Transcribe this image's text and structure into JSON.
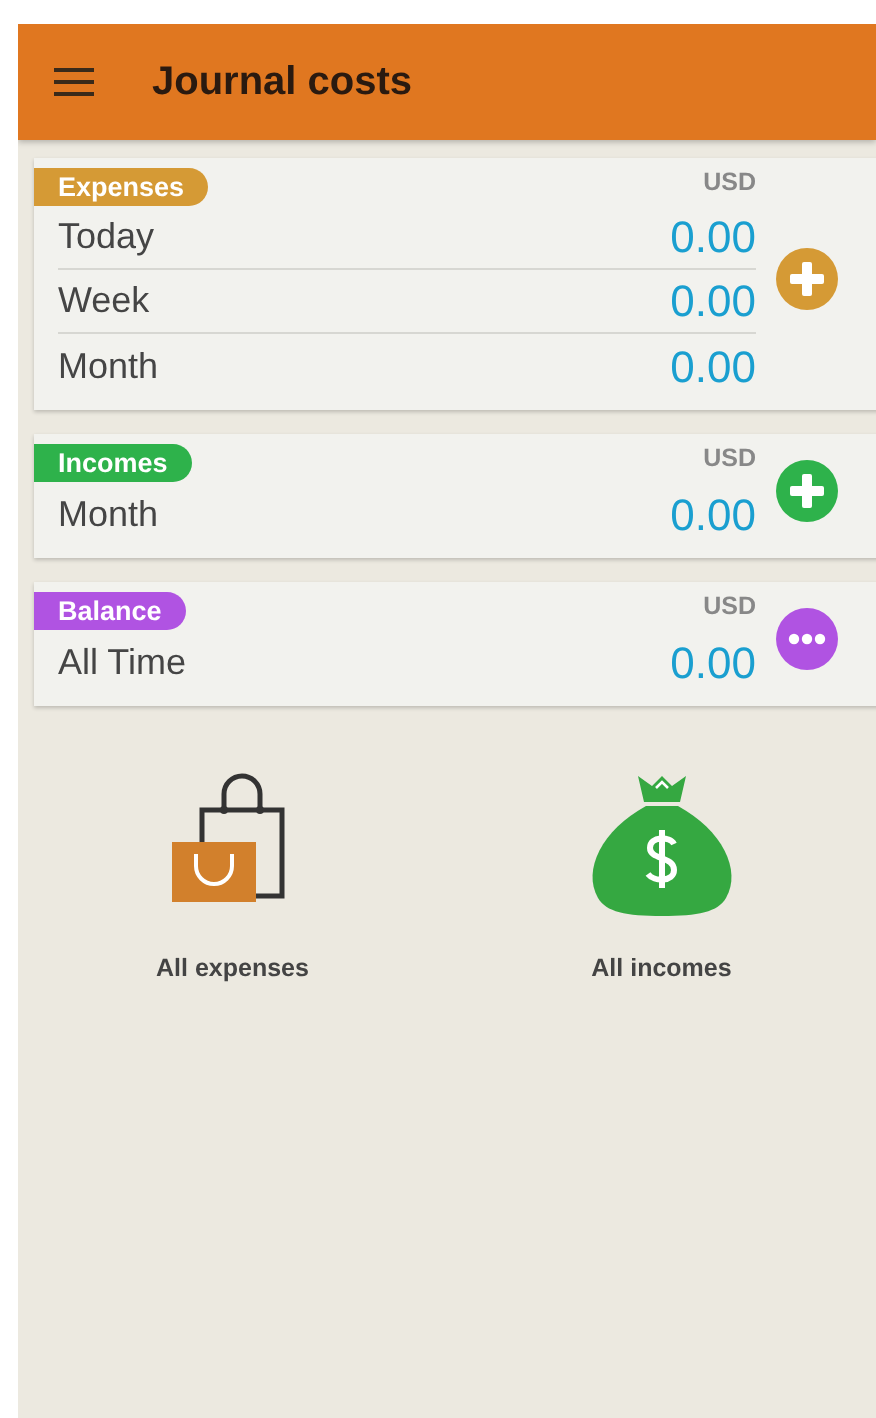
{
  "app_bar": {
    "title": "Journal costs"
  },
  "sections": [
    {
      "title": "Expenses",
      "color": "#d59a35",
      "currency": "USD",
      "action": {
        "kind": "add"
      },
      "rows": [
        {
          "label": "Today",
          "value": "0.00"
        },
        {
          "label": "Week",
          "value": "0.00"
        },
        {
          "label": "Month",
          "value": "0.00"
        }
      ]
    },
    {
      "title": "Incomes",
      "color": "#2eb24b",
      "currency": "USD",
      "action": {
        "kind": "add"
      },
      "rows": [
        {
          "label": "Month",
          "value": "0.00"
        }
      ]
    },
    {
      "title": "Balance",
      "color": "#b053e2",
      "currency": "USD",
      "action": {
        "kind": "more"
      },
      "rows": [
        {
          "label": "All Time",
          "value": "0.00"
        }
      ]
    }
  ],
  "shortcuts": [
    {
      "label": "All expenses",
      "kind": "bags"
    },
    {
      "label": "All incomes",
      "kind": "money-bag"
    }
  ]
}
